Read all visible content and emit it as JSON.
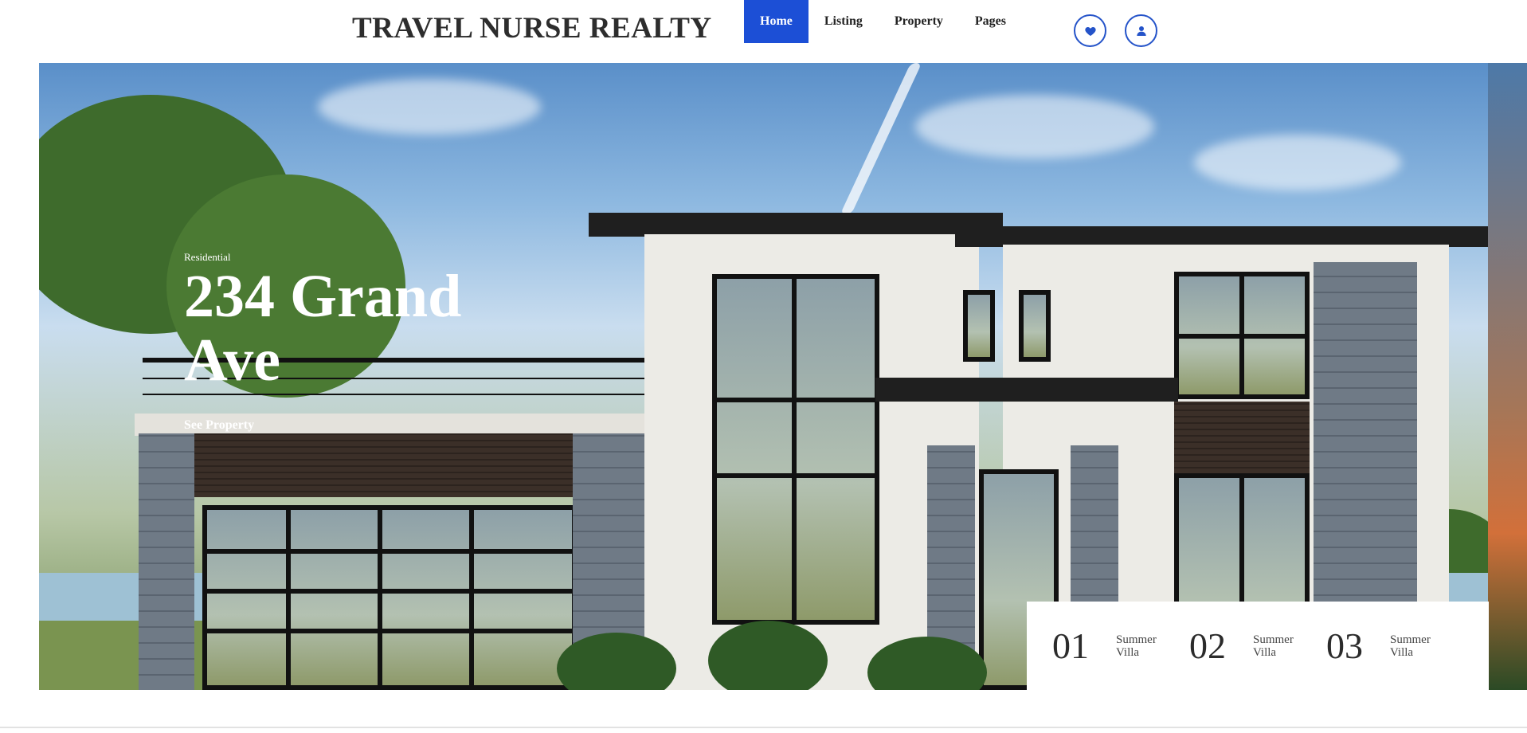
{
  "brand": {
    "name": "TRAVEL NURSE REALTY"
  },
  "nav": {
    "items": [
      {
        "label": "Home",
        "active": true
      },
      {
        "label": "Listing",
        "active": false
      },
      {
        "label": "Property",
        "active": false
      },
      {
        "label": "Pages",
        "active": false
      }
    ],
    "accent_color": "#1c4fd6"
  },
  "header_icons": [
    {
      "name": "heart-icon"
    },
    {
      "name": "user-icon"
    }
  ],
  "hero": {
    "category": "Residential",
    "title": "234 Grand Ave",
    "link_label": "See Property"
  },
  "slider": {
    "items": [
      {
        "number": "01",
        "label": "Summer Villa"
      },
      {
        "number": "02",
        "label": "Summer Villa"
      },
      {
        "number": "03",
        "label": "Summer Villa"
      }
    ]
  }
}
